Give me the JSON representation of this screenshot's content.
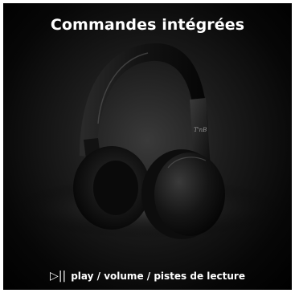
{
  "title": "Commandes intégrées",
  "caption": {
    "icon": "play-pause-icon",
    "glyph": "▷||",
    "text": "play / volume / pistes de lecture"
  },
  "product": {
    "brand_mark": "T'nB"
  },
  "colors": {
    "text": "#ffffff",
    "background": "#0a0a0a"
  }
}
